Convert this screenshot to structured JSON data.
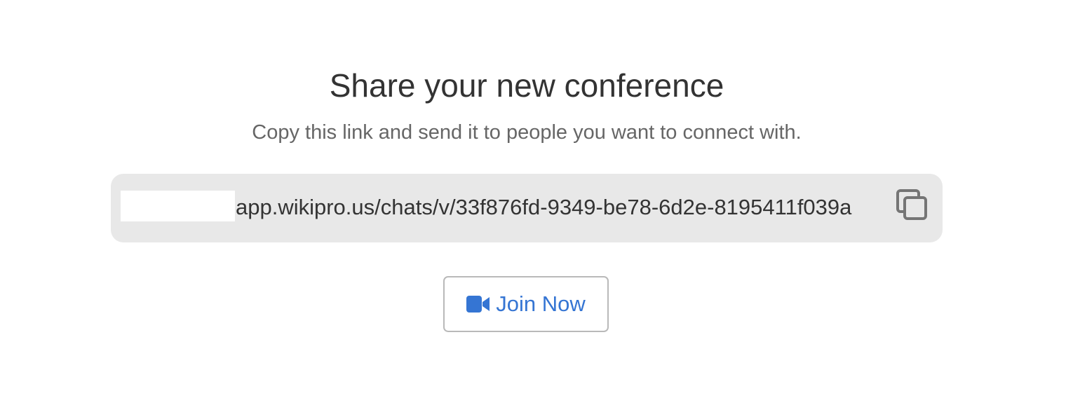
{
  "header": {
    "title": "Share your new conference",
    "subtitle": "Copy this link and send it to people you want to connect with."
  },
  "link": {
    "url": "app.wikipro.us/chats/v/33f876fd-9349-be78-6d2e-8195411f039a",
    "copy_icon": "copy-icon"
  },
  "join": {
    "label": "Join Now",
    "icon": "video-camera-icon"
  },
  "colors": {
    "accent": "#3575d3",
    "link_box_bg": "#e8e8e8",
    "title": "#333333",
    "subtitle": "#666666"
  }
}
